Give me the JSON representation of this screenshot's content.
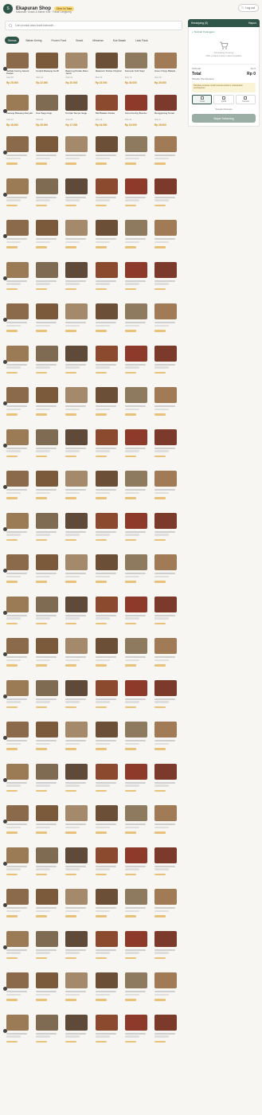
{
  "header": {
    "logo_text": "S",
    "shop_name": "Ekapuran Shop",
    "badge": "Dine In/Take",
    "subtitle": "Makanan, Snack & Bahan Kue · Pasar Langsung",
    "icon": "log-out-icon",
    "right_button": "Log out"
  },
  "search": {
    "placeholder": "Cari produk atau kode barcode..."
  },
  "tabs": [
    "Semua",
    "Bahan Kering",
    "Frozen Food",
    "Snack",
    "Minuman",
    "Kue Basah",
    "Lauk Pauk"
  ],
  "grid": {
    "columns": 6,
    "row_markers": 24,
    "placeholder_color": "#d8d8d8",
    "products": [
      {
        "name": "Seblak Kering Jeletot Pedas",
        "sub": "Stok 20",
        "price": "Rp 25.000",
        "color": "#8a6a4a"
      },
      {
        "name": "Keripik Bawang Gurih",
        "sub": "Stok 18",
        "price": "Rp 22.000",
        "color": "#7a5a3a"
      },
      {
        "name": "Basreng Pedas Daun Jeruk",
        "sub": "Stok 14",
        "price": "Rp 20.000",
        "color": "#a48a6a"
      },
      {
        "name": "Makaroni Pedas Original",
        "sub": "Stok 30",
        "price": "Rp 15.000",
        "color": "#6b4f36"
      },
      {
        "name": "Kerupuk Kulit Sapi",
        "sub": "Stok 12",
        "price": "Rp 30.000",
        "color": "#8e7a5e"
      },
      {
        "name": "Usus Crispy Balado",
        "sub": "Stok 16",
        "price": "Rp 25.000",
        "color": "#a07b55"
      },
      {
        "name": "Kacang Bawang Renyah",
        "sub": "Stok 22",
        "price": "Rp 18.000",
        "color": "#9b7a56"
      },
      {
        "name": "Kue Sagu Keju",
        "sub": "Stok 10",
        "price": "Rp 35.000",
        "color": "#7f6a52"
      },
      {
        "name": "Keripik Tempe Sagu",
        "sub": "Stok 25",
        "price": "Rp 17.000",
        "color": "#5f4a3a"
      },
      {
        "name": "Stik Balado Pedas",
        "sub": "Stok 19",
        "price": "Rp 16.000",
        "color": "#8b4a2e"
      },
      {
        "name": "Cimol Kering Bumbu",
        "sub": "Stok 21",
        "price": "Rp 15.000",
        "color": "#8e3a2a"
      },
      {
        "name": "Rengginang Terasi",
        "sub": "Stok 9",
        "price": "Rp 28.000",
        "color": "#7b3a2a"
      }
    ]
  },
  "panel": {
    "header_title": "Keranjang (0)",
    "header_action": "Hapus",
    "customer_link": "+ Tambah Pelanggan",
    "empty_title": "Keranjang Kosong",
    "empty_hint": "Pilih produk untuk mulai transaksi",
    "subtotal_label": "Subtotal",
    "subtotal_value": "Rp 0",
    "total_label": "Total",
    "total_value": "Rp 0",
    "payment_label": "Metode Pembayaran",
    "note": "Pastikan pesanan sudah sesuai sebelum melanjutkan pembayaran.",
    "pay_methods": [
      {
        "label": "Tunai",
        "icon": "cash-icon"
      },
      {
        "label": "QRIS",
        "icon": "qr-icon"
      },
      {
        "label": "Transfer",
        "icon": "transfer-icon"
      }
    ],
    "secondary": "Simpan Pesanan",
    "primary": "Bayar Sekarang",
    "colors": {
      "accent": "#2f5548",
      "price": "#c88a10",
      "disabled": "#9aaea6"
    }
  }
}
